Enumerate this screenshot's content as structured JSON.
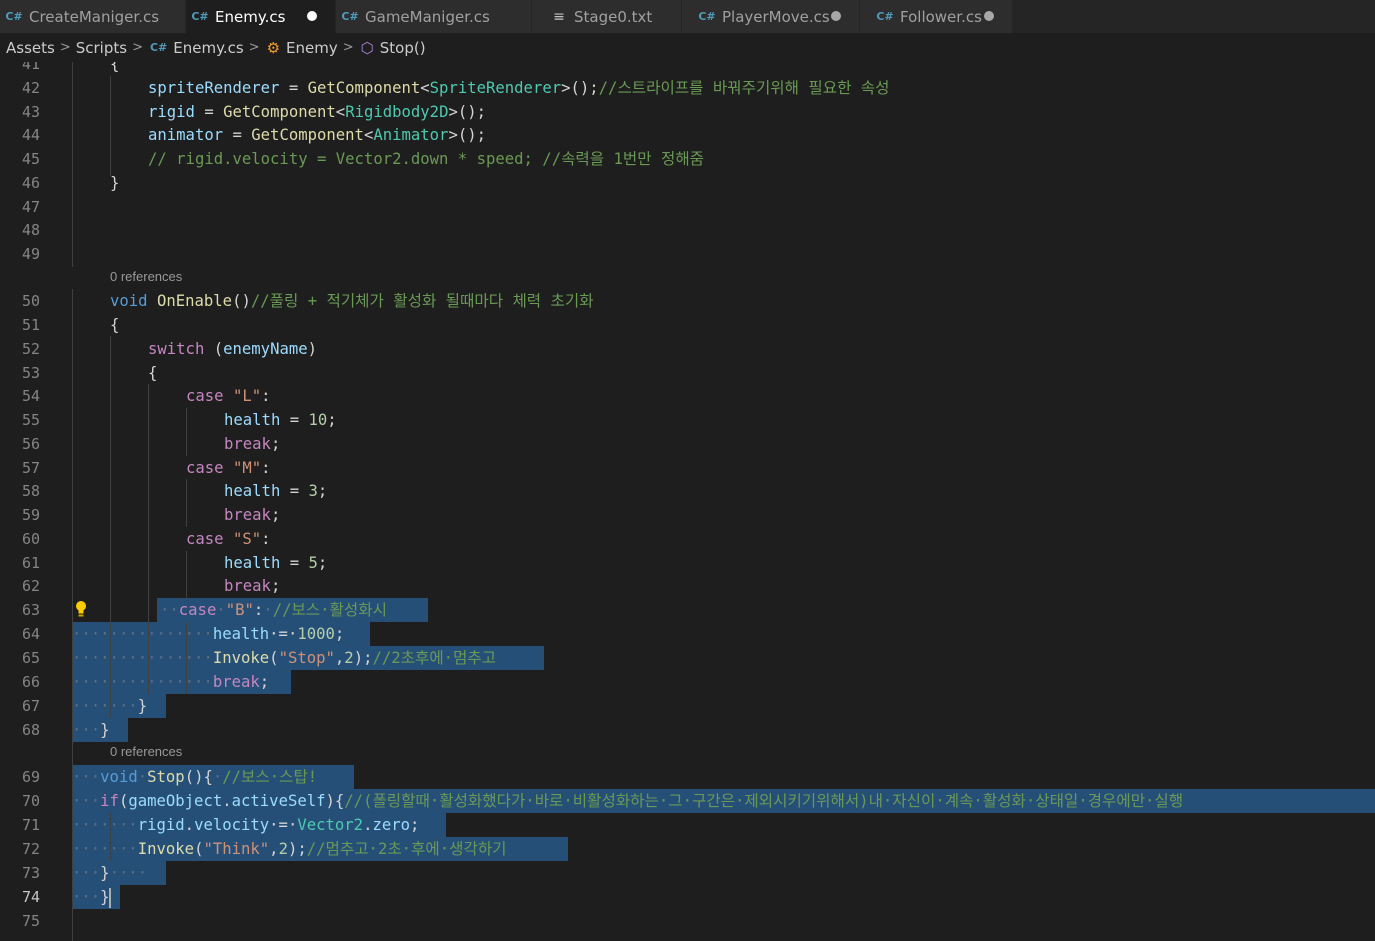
{
  "tabs": [
    {
      "label": "CreateManiger.cs",
      "icon": "csharp-icon",
      "active": false,
      "dirty": false
    },
    {
      "label": "Enemy.cs",
      "icon": "csharp-icon",
      "active": true,
      "dirty": true
    },
    {
      "label": "GameManiger.cs",
      "icon": "csharp-icon",
      "active": false,
      "dirty": false
    },
    {
      "label": "Stage0.txt",
      "icon": "text-file-icon",
      "active": false,
      "dirty": false
    },
    {
      "label": "PlayerMove.cs",
      "icon": "csharp-icon",
      "active": false,
      "dirty": true
    },
    {
      "label": "Follower.cs",
      "icon": "csharp-icon",
      "active": false,
      "dirty": true
    }
  ],
  "breadcrumb": {
    "assets": "Assets",
    "scripts": "Scripts",
    "file": "Enemy.cs",
    "class": "Enemy",
    "method": "Stop()"
  },
  "editor": {
    "line_numbers": [
      "41",
      "42",
      "43",
      "44",
      "45",
      "46",
      "47",
      "48",
      "49",
      "50",
      "51",
      "52",
      "53",
      "54",
      "55",
      "56",
      "57",
      "58",
      "59",
      "60",
      "61",
      "62",
      "63",
      "64",
      "65",
      "66",
      "67",
      "68",
      "69",
      "70",
      "71",
      "72",
      "73",
      "74",
      "75"
    ],
    "current_line": "74",
    "codelens_1": "0 references",
    "codelens_2": "0 references",
    "code": {
      "l42a": "spriteRenderer",
      "l42b": " = ",
      "l42c": "GetComponent",
      "l42d": "<",
      "l42e": "SpriteRenderer",
      "l42f": ">();",
      "l42g": "//스트라이프를 바꿔주기위해 필요한 속성",
      "l43a": "rigid",
      "l43b": " = ",
      "l43c": "GetComponent",
      "l43d": "<",
      "l43e": "Rigidbody2D",
      "l43f": ">();",
      "l44a": "animator",
      "l44b": " = ",
      "l44c": "GetComponent",
      "l44d": "<",
      "l44e": "Animator",
      "l44f": ">();",
      "l45": "// rigid.velocity = Vector2.down * speed; //속력을 1번만 정해줌",
      "l46": "}",
      "l50a": "void",
      "l50b": "OnEnable",
      "l50c": "()",
      "l50d": "//풀링 + 적기체가 활성화 될때마다 체력 초기화",
      "l51": "{",
      "l52a": "switch",
      "l52b": " (",
      "l52c": "enemyName",
      "l52d": ")",
      "l53": "{",
      "l54a": "case",
      "l54b": "\"L\"",
      "l54c": ":",
      "l55a": "health",
      "l55b": " = ",
      "l55c": "10",
      "l55d": ";",
      "l56": "break",
      "l57a": "case",
      "l57b": "\"M\"",
      "l57c": ":",
      "l58a": "health",
      "l58b": " = ",
      "l58c": "3",
      "l58d": ";",
      "l59": "break",
      "l60a": "case",
      "l60b": "\"S\"",
      "l60c": ":",
      "l61a": "health",
      "l61b": " = ",
      "l61c": "5",
      "l61d": ";",
      "l62": "break",
      "l63a": "case",
      "l63b": "\"B\"",
      "l63c": ":",
      "l63d": "//보스·활성화시",
      "l64a": "health",
      "l64b": "·=·",
      "l64c": "1000",
      "l64d": ";",
      "l65a": "Invoke",
      "l65b": "(",
      "l65c": "\"Stop\"",
      "l65d": ",",
      "l65e": "2",
      "l65f": ");",
      "l65g": "//2초후에·멈추고",
      "l66": "break",
      "l67": "}",
      "l68": "}",
      "l69a": "void",
      "l69b": "Stop",
      "l69c": "(){",
      "l69d": "//보스·스탑!",
      "l70a": "if",
      "l70b": "(",
      "l70c": "gameObject",
      "l70d": ".",
      "l70e": "activeSelf",
      "l70f": "){",
      "l70g": "//(폴링할때·활성화했다가·바로·비활성화하는·그·구간은·제외시키기위해서)내·자신이·계속·활성화·상태일·경우에만·실행",
      "l71a": "rigid",
      "l71b": ".",
      "l71c": "velocity",
      "l71d": "·=·",
      "l71e": "Vector2",
      "l71f": ".",
      "l71g": "zero",
      "l71h": ";",
      "l72a": "Invoke",
      "l72b": "(",
      "l72c": "\"Think\"",
      "l72d": ",",
      "l72e": "2",
      "l72f": ");",
      "l72g": "//멈추고·2초·후에·생각하기",
      "l73": "}",
      "l74": "}"
    }
  }
}
